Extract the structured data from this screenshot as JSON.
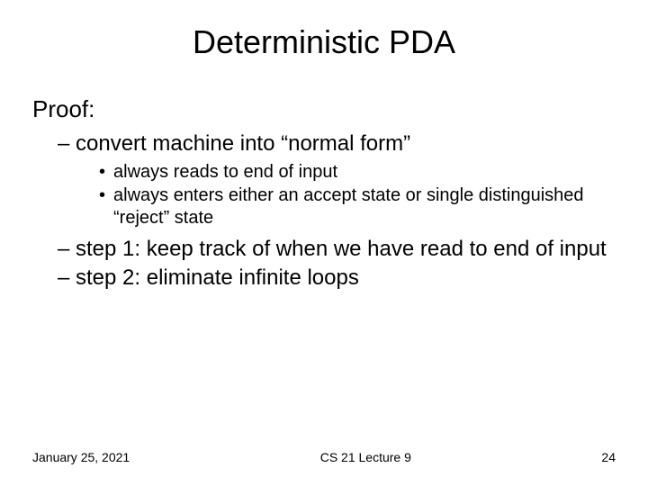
{
  "title": "Deterministic PDA",
  "proof_label": "Proof:",
  "items": [
    {
      "text": "convert machine into “normal form”",
      "sub": [
        "always reads to end of input",
        "always enters either an accept state or single distinguished “reject” state"
      ]
    },
    {
      "text": "step 1: keep track of when we have read to end of input"
    },
    {
      "text": "step 2: eliminate infinite loops"
    }
  ],
  "footer": {
    "date": "January 25, 2021",
    "course": "CS 21 Lecture 9",
    "page": "24"
  }
}
